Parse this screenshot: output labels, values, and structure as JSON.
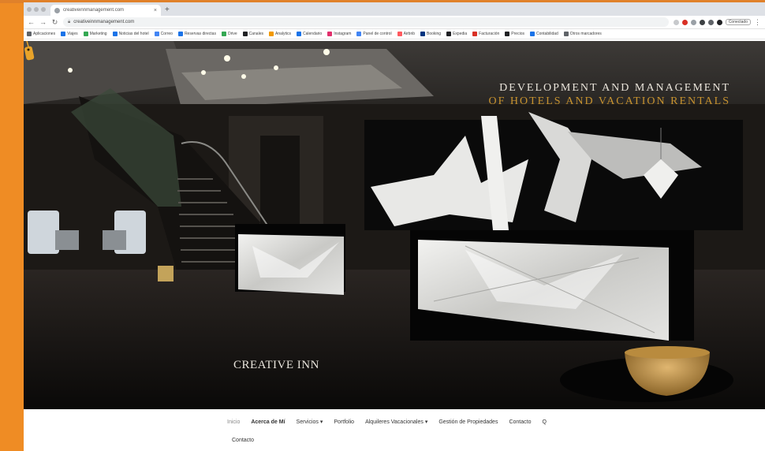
{
  "browser": {
    "tab_title": "creativeinnmanagement.com",
    "new_tab_symbol": "+",
    "close_symbol": "×",
    "url": "creativeinnmanagement.com",
    "profile_label": "Conectado",
    "bookmarks": [
      {
        "label": "Aplicaciones",
        "color": "#5f6368"
      },
      {
        "label": "Viajes",
        "color": "#1a73e8"
      },
      {
        "label": "Marketing",
        "color": "#34a853"
      },
      {
        "label": "Noticias del hotel",
        "color": "#1a73e8"
      },
      {
        "label": "Correo",
        "color": "#4285f4"
      },
      {
        "label": "Reservas directas",
        "color": "#1a73e8"
      },
      {
        "label": "Drive",
        "color": "#34a853"
      },
      {
        "label": "Canales",
        "color": "#202124"
      },
      {
        "label": "Analytics",
        "color": "#f29900"
      },
      {
        "label": "Calendario",
        "color": "#1a73e8"
      },
      {
        "label": "Instagram",
        "color": "#e1306c"
      },
      {
        "label": "Panel de control",
        "color": "#4285f4"
      },
      {
        "label": "Airbnb",
        "color": "#ff5a5f"
      },
      {
        "label": "Booking",
        "color": "#003580"
      },
      {
        "label": "Expedia",
        "color": "#202124"
      },
      {
        "label": "Facturación",
        "color": "#d93025"
      },
      {
        "label": "Precios",
        "color": "#202124"
      },
      {
        "label": "Contabilidad",
        "color": "#1a73e8"
      },
      {
        "label": "Otros marcadores",
        "color": "#5f6368"
      }
    ]
  },
  "hero": {
    "tagline_line1": "DEVELOPMENT AND MANAGEMENT",
    "tagline_line2": "OF HOTELS AND VACATION RENTALS",
    "logo_text": "CREATIVE INN"
  },
  "nav": {
    "items": [
      {
        "label": "Inicio",
        "style": "active"
      },
      {
        "label": "Acerca de Mí",
        "style": "bold"
      },
      {
        "label": "Servicios ▾",
        "style": ""
      },
      {
        "label": "Portfolio",
        "style": ""
      },
      {
        "label": "Alquileres Vacacionales ▾",
        "style": ""
      },
      {
        "label": "Gestión de Propiedades",
        "style": ""
      },
      {
        "label": "Contacto",
        "style": ""
      },
      {
        "label": "Q",
        "style": ""
      }
    ],
    "second_row": "Contacto"
  },
  "colors": {
    "frame": "#ef8c24",
    "gold_accent": "#c8932f",
    "hero_bg": "#0d0c0c"
  }
}
